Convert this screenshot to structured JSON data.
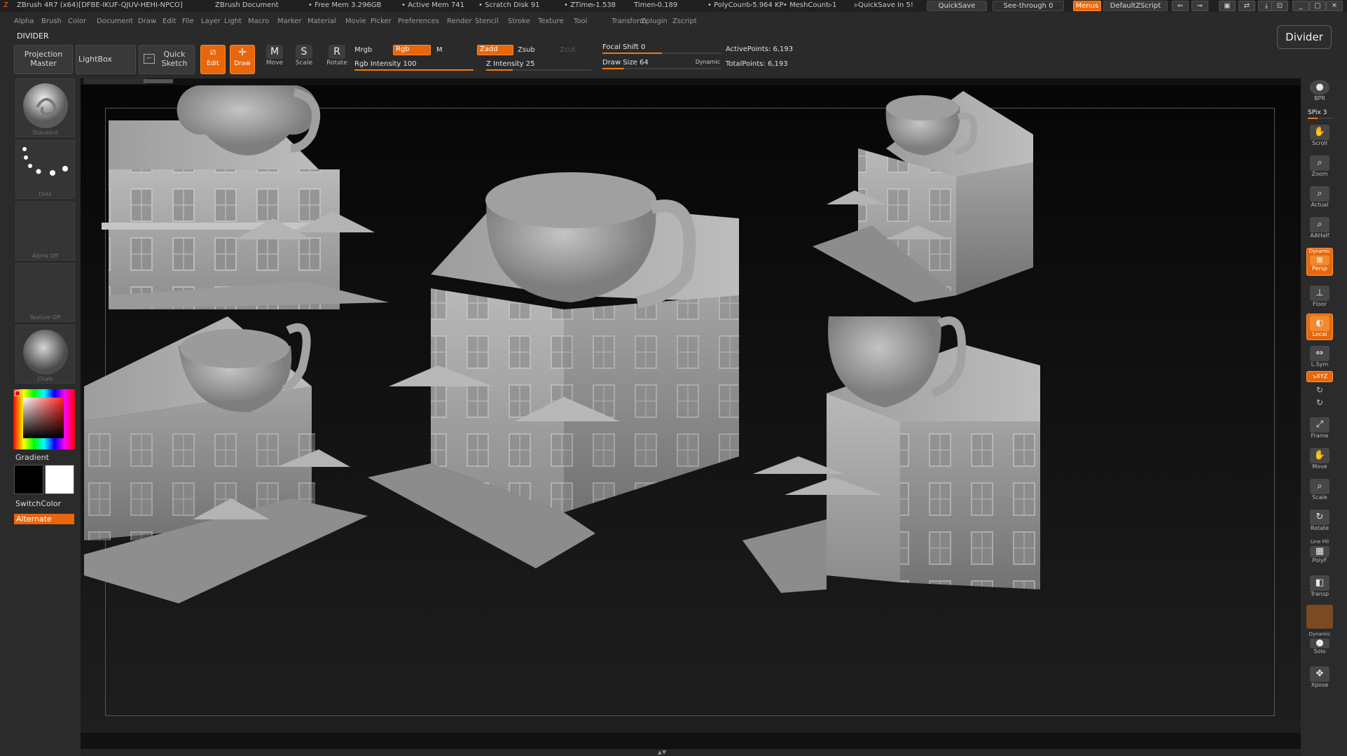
{
  "titlebar": {
    "app": "ZBrush 4R7 (x64)[DFBE-IKUF-QJUV-HEHI-NPCO]",
    "document": "ZBrush Document",
    "free_mem": "• Free Mem 3.296GB",
    "active_mem": "• Active Mem 741",
    "scratch_disk": "• Scratch Disk 91",
    "ztime": "• ZTime▹1.538",
    "timer": "Timer▹0.189",
    "polycount": "• PolyCount▹5.964 KP",
    "meshcount": "• MeshCount▹1",
    "quicksave_in": "▹QuickSave In 5!",
    "quicksave_button": "QuickSave",
    "see_through": "See-through  0",
    "menus_button": "Menus",
    "script_button": "DefaultZScript"
  },
  "menu": [
    "Alpha",
    "Brush",
    "Color",
    "Document",
    "Draw",
    "Edit",
    "File",
    "Layer",
    "Light",
    "Macro",
    "Marker",
    "Material",
    "Movie",
    "Picker",
    "Preferences",
    "Render",
    "Stencil",
    "Stroke",
    "Texture",
    "Tool",
    "Transform",
    "Zplugin",
    "Zscript"
  ],
  "palette_title": "DIVIDER",
  "divider_button": "Divider",
  "toolbar": {
    "projection_master": [
      "Projection",
      "Master"
    ],
    "lightbox": "LightBox",
    "quick_sketch": [
      "Quick",
      "Sketch"
    ],
    "edit": "Edit",
    "draw": "Draw",
    "move": "Move",
    "scale": "Scale",
    "rotate": "Rotate",
    "mrgb": "Mrgb",
    "rgb": "Rgb",
    "m": "M",
    "zadd": "Zadd",
    "zsub": "Zsub",
    "zcut": "Zcut",
    "rgb_intensity": "Rgb Intensity 100",
    "rgb_intensity_value": 1.0,
    "z_intensity": "Z Intensity 25",
    "z_intensity_value": 0.25,
    "focal_shift": "Focal Shift 0",
    "focal_shift_value": 0.5,
    "draw_size": "Draw Size 64",
    "draw_size_value": 0.18,
    "dynamic": "Dynamic",
    "active_points": "ActivePoints: 6,193",
    "total_points": "TotalPoints: 6,193"
  },
  "left_shelf": {
    "brush": "Standard",
    "stroke": "Dots",
    "alpha": "Alpha Off",
    "texture": "Texture Off",
    "material": "Chalk",
    "gradient": "Gradient",
    "switch_color": "SwitchColor",
    "alternate": "Alternate"
  },
  "right_shelf": {
    "bpr": "BPR",
    "spix": "SPix 3",
    "scroll": "Scroll",
    "zoom": "Zoom",
    "actual": "Actual",
    "aahalf": "AAHalf",
    "dynamic": "Dynamic",
    "persp": "Persp",
    "floor": "Floor",
    "local": "Local",
    "lsym": "L.Sym",
    "xyz": "↘XYZ",
    "frame": "Frame",
    "move": "Move",
    "scale": "Scale",
    "rotate": "Rotate",
    "line_fill": "Line Fill",
    "polyf": "PolyF",
    "transp": "Transp",
    "dynamic2": "Dynamic",
    "solo": "Solo",
    "xpose": "Xpose"
  },
  "icons": {
    "edit": "pencil-frame-icon",
    "draw": "crosshair-icon",
    "move": "move-m-icon",
    "scale": "scale-s-icon",
    "rotate": "rotate-r-icon"
  },
  "colors": {
    "accent": "#e8670c",
    "panel": "#2a2a2a",
    "canvas": "#111111"
  }
}
